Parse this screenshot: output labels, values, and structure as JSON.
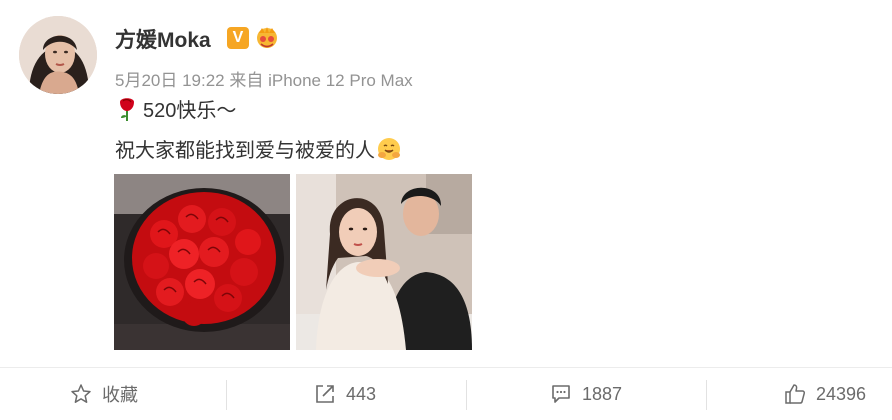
{
  "post": {
    "author": "方媛Moka",
    "verified_badge": "V",
    "meta": "5月20日 19:22 来自 iPhone 12 Pro Max",
    "line1": "520快乐～",
    "line2": "祝大家都能找到爱与被爱的人",
    "line1_emoji": "rose-icon",
    "line2_emoji": "hug-emoji-icon"
  },
  "actions": {
    "favorite_label": "收藏",
    "share_count": "443",
    "comment_count": "1887",
    "like_count": "24396"
  },
  "colors": {
    "badge": "#f6a623",
    "meta_text": "#939393",
    "action_text": "#6b6b6b"
  }
}
